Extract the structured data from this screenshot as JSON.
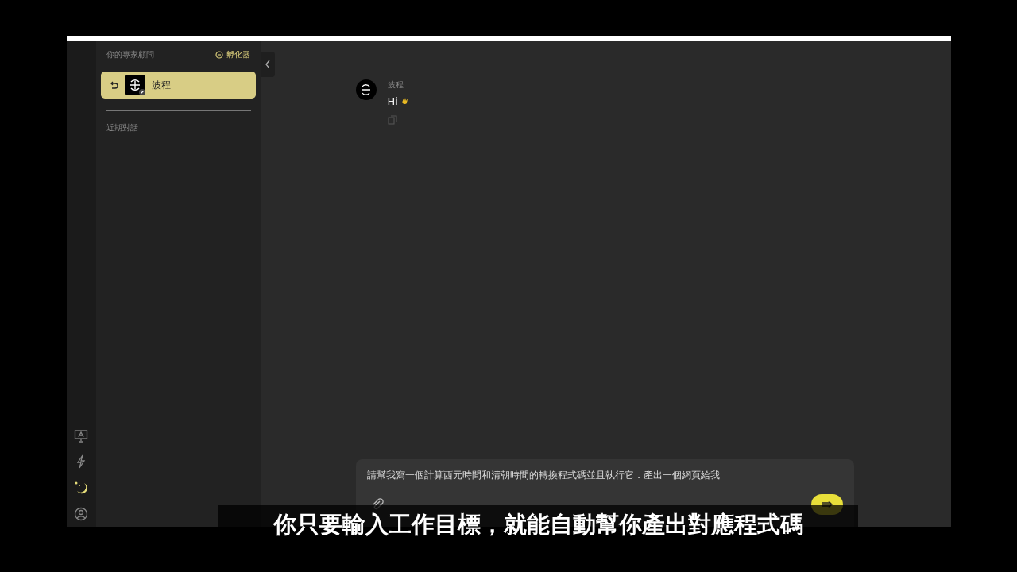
{
  "sidebar": {
    "title": "你的專家顧問",
    "incubator_link": "孵化器",
    "active_expert": {
      "name": "波程"
    },
    "recent_heading": "近期對話"
  },
  "rail": [
    {
      "kind": "presentation",
      "selected": false
    },
    {
      "kind": "bolt",
      "selected": false
    },
    {
      "kind": "moon",
      "selected": true
    },
    {
      "kind": "account",
      "selected": false
    }
  ],
  "messages": [
    {
      "sender": "波程",
      "text": "Hi"
    }
  ],
  "composer": {
    "value": "請幫我寫一個計算西元時間和清朝時間的轉換程式碼並且執行它．產出一個網頁給我"
  },
  "caption": "你只要輸入工作目標，就能自動幫你產出對應程式碼"
}
